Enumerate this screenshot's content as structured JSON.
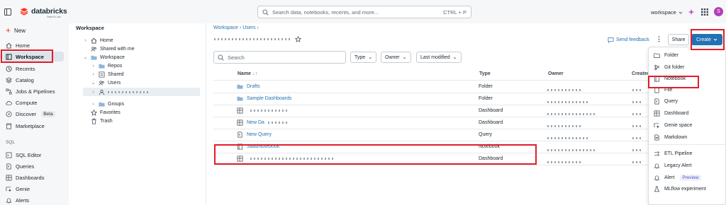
{
  "brand": {
    "name": "databricks",
    "tagline": "Data+AI Lab"
  },
  "search": {
    "placeholder": "Search data, notebooks, recents, and more...",
    "shortcut": "CTRL + P"
  },
  "workspace_selector": "workspace",
  "user_initial": "S",
  "nav": {
    "new_label": "New",
    "items": [
      "Home",
      "Workspace",
      "Recents",
      "Catalog",
      "Jobs & Pipelines",
      "Compute",
      "Discover",
      "Marketplace"
    ],
    "discover_badge": "Beta",
    "sql_section": "SQL",
    "sql_items": [
      "SQL Editor",
      "Queries",
      "Dashboards",
      "Genie",
      "Alerts"
    ]
  },
  "tree": {
    "title": "Workspace",
    "items": [
      "Home",
      "Shared with me",
      "Workspace",
      "Repos",
      "Shared",
      "Users",
      "Groups",
      "Favorites",
      "Trash"
    ]
  },
  "breadcrumb": [
    "Workspace",
    "Users"
  ],
  "header": {
    "send_feedback": "Send feedback",
    "share": "Share",
    "create": "Create"
  },
  "toolbar": {
    "search_placeholder": "Search",
    "filters": [
      "Type",
      "Owner",
      "Last modified"
    ]
  },
  "table": {
    "columns": [
      "Name",
      "Type",
      "Owner",
      "Created"
    ],
    "rows": [
      {
        "name": "Drafts",
        "type": "Folder",
        "icon": "folder-icon"
      },
      {
        "name": "Sample Dashboards",
        "type": "Folder",
        "icon": "folder-icon"
      },
      {
        "name": "",
        "type": "Dashboard",
        "icon": "dashboard-icon"
      },
      {
        "name": "New Da",
        "type": "Dashboard",
        "icon": "dashboard-icon"
      },
      {
        "name": "New Query",
        "type": "Query",
        "icon": "query-icon"
      },
      {
        "name": "SaadNotebook",
        "type": "Notebook",
        "icon": "notebook-icon"
      },
      {
        "name": "",
        "type": "Dashboard",
        "icon": "dashboard-icon"
      }
    ]
  },
  "create_menu": {
    "items": [
      "Folder",
      "Git folder",
      "Notebook",
      "File",
      "Query",
      "Dashboard",
      "Genie space",
      "Markdown",
      "ETL Pipeline",
      "Legacy Alert",
      "Alert",
      "MLflow experiment"
    ],
    "alert_badge": "Preview"
  },
  "colors": {
    "accent": "#2272b4",
    "brand": "#ff3621",
    "highlight": "#e11d2a"
  }
}
